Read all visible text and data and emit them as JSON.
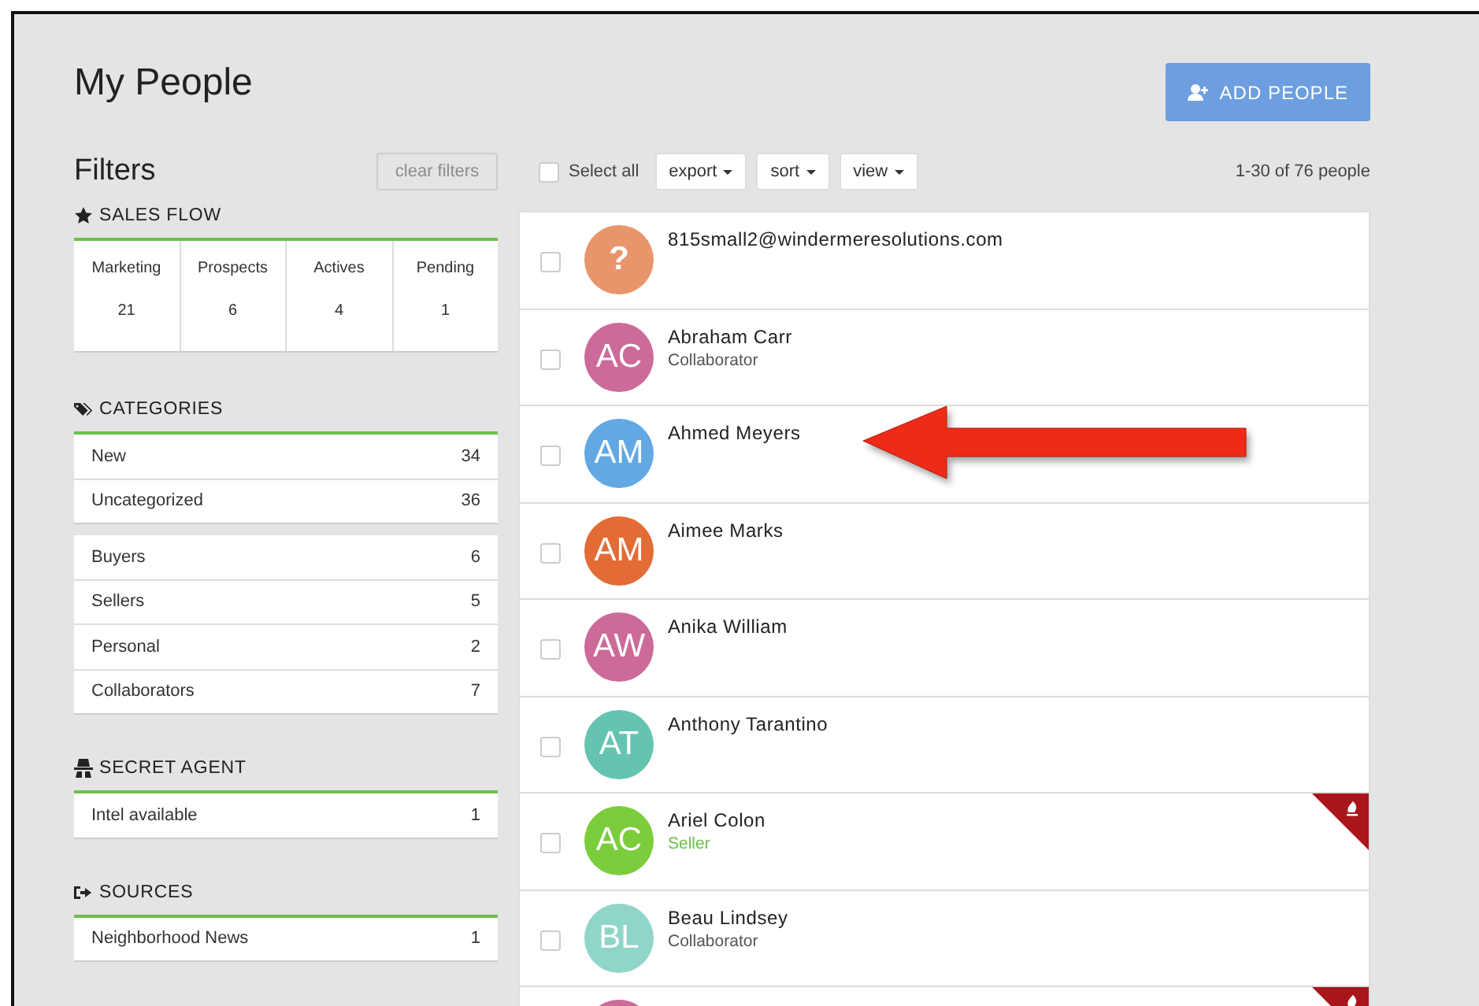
{
  "page": {
    "title": "My People",
    "add_button": "ADD PEOPLE"
  },
  "filters": {
    "title": "Filters",
    "clear_button": "clear filters",
    "sections": [
      {
        "kind": "flow",
        "title": "SALES FLOW",
        "stages": [
          {
            "label": "Marketing",
            "count": "21"
          },
          {
            "label": "Prospects",
            "count": "6"
          },
          {
            "label": "Actives",
            "count": "4"
          },
          {
            "label": "Pending",
            "count": "1"
          }
        ]
      },
      {
        "kind": "list",
        "title": "CATEGORIES",
        "groups": [
          [
            {
              "label": "New",
              "count": "34"
            },
            {
              "label": "Uncategorized",
              "count": "36"
            }
          ],
          [
            {
              "label": "Buyers",
              "count": "6"
            },
            {
              "label": "Sellers",
              "count": "5"
            },
            {
              "label": "Personal",
              "count": "2"
            },
            {
              "label": "Collaborators",
              "count": "7"
            }
          ]
        ]
      },
      {
        "kind": "list",
        "title": "SECRET AGENT",
        "groups": [
          [
            {
              "label": "Intel available",
              "count": "1"
            }
          ]
        ]
      },
      {
        "kind": "list",
        "title": "SOURCES",
        "groups": [
          [
            {
              "label": "Neighborhood News",
              "count": "1"
            }
          ]
        ]
      }
    ]
  },
  "toolbar": {
    "select_all": {
      "label": "Select all",
      "checked": false
    },
    "menus": [
      "export",
      "sort",
      "view"
    ],
    "count": "1-30 of 76 people"
  },
  "people": [
    {
      "initials": "?",
      "color": "#e8956b",
      "name": "815small2@windermeresolutions.com",
      "checked": false,
      "flagged": false
    },
    {
      "initials": "AC",
      "color": "#cc6a99",
      "name": "Abraham Carr",
      "role": "Collaborator",
      "role_highlighted": false,
      "checked": false,
      "flagged": false
    },
    {
      "initials": "AM",
      "color": "#62a9e3",
      "name": "Ahmed Meyers",
      "checked": false,
      "flagged": false,
      "pointed": true
    },
    {
      "initials": "AM",
      "color": "#e36b35",
      "name": "Aimee Marks",
      "checked": false,
      "flagged": false
    },
    {
      "initials": "AW",
      "color": "#cc6a99",
      "name": "Anika William",
      "checked": false,
      "flagged": false
    },
    {
      "initials": "AT",
      "color": "#64c4b0",
      "name": "Anthony Tarantino",
      "checked": false,
      "flagged": false
    },
    {
      "initials": "AC",
      "color": "#7bcd3c",
      "name": "Ariel Colon",
      "role": "Seller",
      "role_highlighted": true,
      "checked": false,
      "flagged": true
    },
    {
      "initials": "BL",
      "color": "#8fd6c9",
      "name": "Beau Lindsey",
      "role": "Collaborator",
      "role_highlighted": false,
      "checked": false,
      "flagged": false
    },
    {
      "color": "#cc6a99",
      "flagged": true
    }
  ]
}
